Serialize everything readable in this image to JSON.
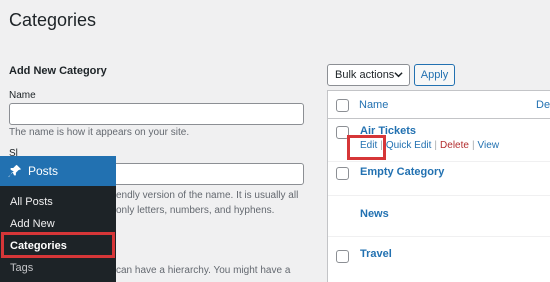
{
  "page": {
    "title": "Categories"
  },
  "form": {
    "heading": "Add New Category",
    "name_label": "Name",
    "name_help": "The name is how it appears on your site.",
    "slug_label_partial": "Sl",
    "slug_help_line1": "endly version of the name. It is usually all",
    "slug_help_line2": "only letters, numbers, and hyphens.",
    "parent_help_line1": "can have a hierarchy. You might have a",
    "parent_help_line2": ""
  },
  "sidebar": {
    "menu_title": "Posts",
    "items": [
      {
        "label": "All Posts",
        "state": "normal"
      },
      {
        "label": "Add New",
        "state": "normal"
      },
      {
        "label": "Categories",
        "state": "current"
      },
      {
        "label": "Tags",
        "state": "normal"
      }
    ]
  },
  "bulk": {
    "select_value": "Bulk actions",
    "apply_label": "Apply"
  },
  "table": {
    "columns": [
      "Name",
      "Des"
    ],
    "rows": [
      {
        "name": "Air Tickets",
        "actions": [
          "Edit",
          "Quick Edit",
          "Delete",
          "View"
        ]
      },
      {
        "name": "Empty Category"
      },
      {
        "name": "News"
      },
      {
        "name": "Travel"
      }
    ]
  },
  "colors": {
    "accent": "#2271b1",
    "highlight": "#d63638",
    "delete": "#b32d2e",
    "sidebar_bg": "#1d2327"
  },
  "icons": {
    "posts_menu": "pushpin-icon",
    "bulk_dropdown": "chevron-down-icon"
  }
}
